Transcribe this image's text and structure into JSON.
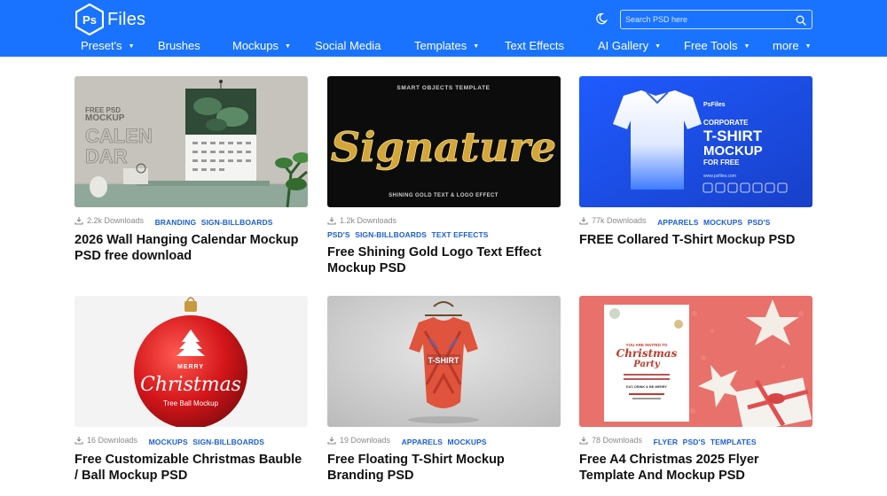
{
  "brand": {
    "logo_mark": "Ps",
    "logo_text": "Files"
  },
  "search": {
    "placeholder": "Search PSD here"
  },
  "icons": {
    "theme": "moon-icon",
    "search": "search-icon",
    "downloads": "download-icon"
  },
  "colors": {
    "header": "#1a73ff",
    "tag": "#1a5fd6"
  },
  "nav": [
    {
      "label": "Preset's",
      "dropdown": true
    },
    {
      "label": "Brushes",
      "dropdown": false
    },
    {
      "label": "Mockups",
      "dropdown": true
    },
    {
      "label": "Social Media",
      "dropdown": false
    },
    {
      "label": "Templates",
      "dropdown": true
    },
    {
      "label": "Text Effects",
      "dropdown": false
    },
    {
      "label": "AI Gallery",
      "dropdown": true
    },
    {
      "label": "Free Tools",
      "dropdown": true
    },
    {
      "label": "more",
      "dropdown": true
    }
  ],
  "cards": [
    {
      "downloads": "2.2k Downloads",
      "tags": [
        "BRANDING",
        "SIGN-BILLBOARDS"
      ],
      "title": "2026 Wall Hanging Calendar Mockup PSD free download",
      "thumb_text": {
        "l1": "FREE PSD",
        "l2": "MOCKUP",
        "l3": "CALEN",
        "l4": "DAR"
      }
    },
    {
      "downloads": "1.2k Downloads",
      "tags": [
        "PSD'S",
        "SIGN-BILLBOARDS",
        "TEXT EFFECTS"
      ],
      "title": "Free Shining Gold Logo Text Effect Mockup PSD",
      "thumb_text": {
        "top": "SMART OBJECTS TEMPLATE",
        "main": "Signature",
        "bottom": "SHINING GOLD TEXT & LOGO EFFECT"
      }
    },
    {
      "downloads": "77k Downloads",
      "tags": [
        "APPARELS",
        "MOCKUPS",
        "PSD'S"
      ],
      "title": "FREE Collared T-Shirt Mockup PSD",
      "thumb_text": {
        "brand": "PsFiles",
        "l1": "CORPORATE",
        "l2": "T-SHIRT",
        "l3": "MOCKUP",
        "l4": "FOR FREE",
        "url": "www.psfiles.com"
      }
    },
    {
      "downloads": "16 Downloads",
      "tags": [
        "MOCKUPS",
        "SIGN-BILLBOARDS"
      ],
      "title": "Free Customizable Christmas Bauble / Ball Mockup PSD",
      "thumb_text": {
        "l1": "MERRY",
        "l2": "Christmas",
        "l3": "Tree Ball Mockup"
      }
    },
    {
      "downloads": "19 Downloads",
      "tags": [
        "APPARELS",
        "MOCKUPS"
      ],
      "title": "Free Floating T-Shirt Mockup Branding PSD",
      "thumb_text": {
        "l1": "T-SHIRT"
      }
    },
    {
      "downloads": "78 Downloads",
      "tags": [
        "FLYER",
        "PSD'S",
        "TEMPLATES"
      ],
      "title": "Free A4 Christmas 2025 Flyer Template And Mockup PSD",
      "thumb_text": {
        "l1": "YOU ARE INVITED TO",
        "l2": "Christmas",
        "l3": "Party",
        "l4": "EAT, DRINK & BE MERRY"
      }
    }
  ]
}
